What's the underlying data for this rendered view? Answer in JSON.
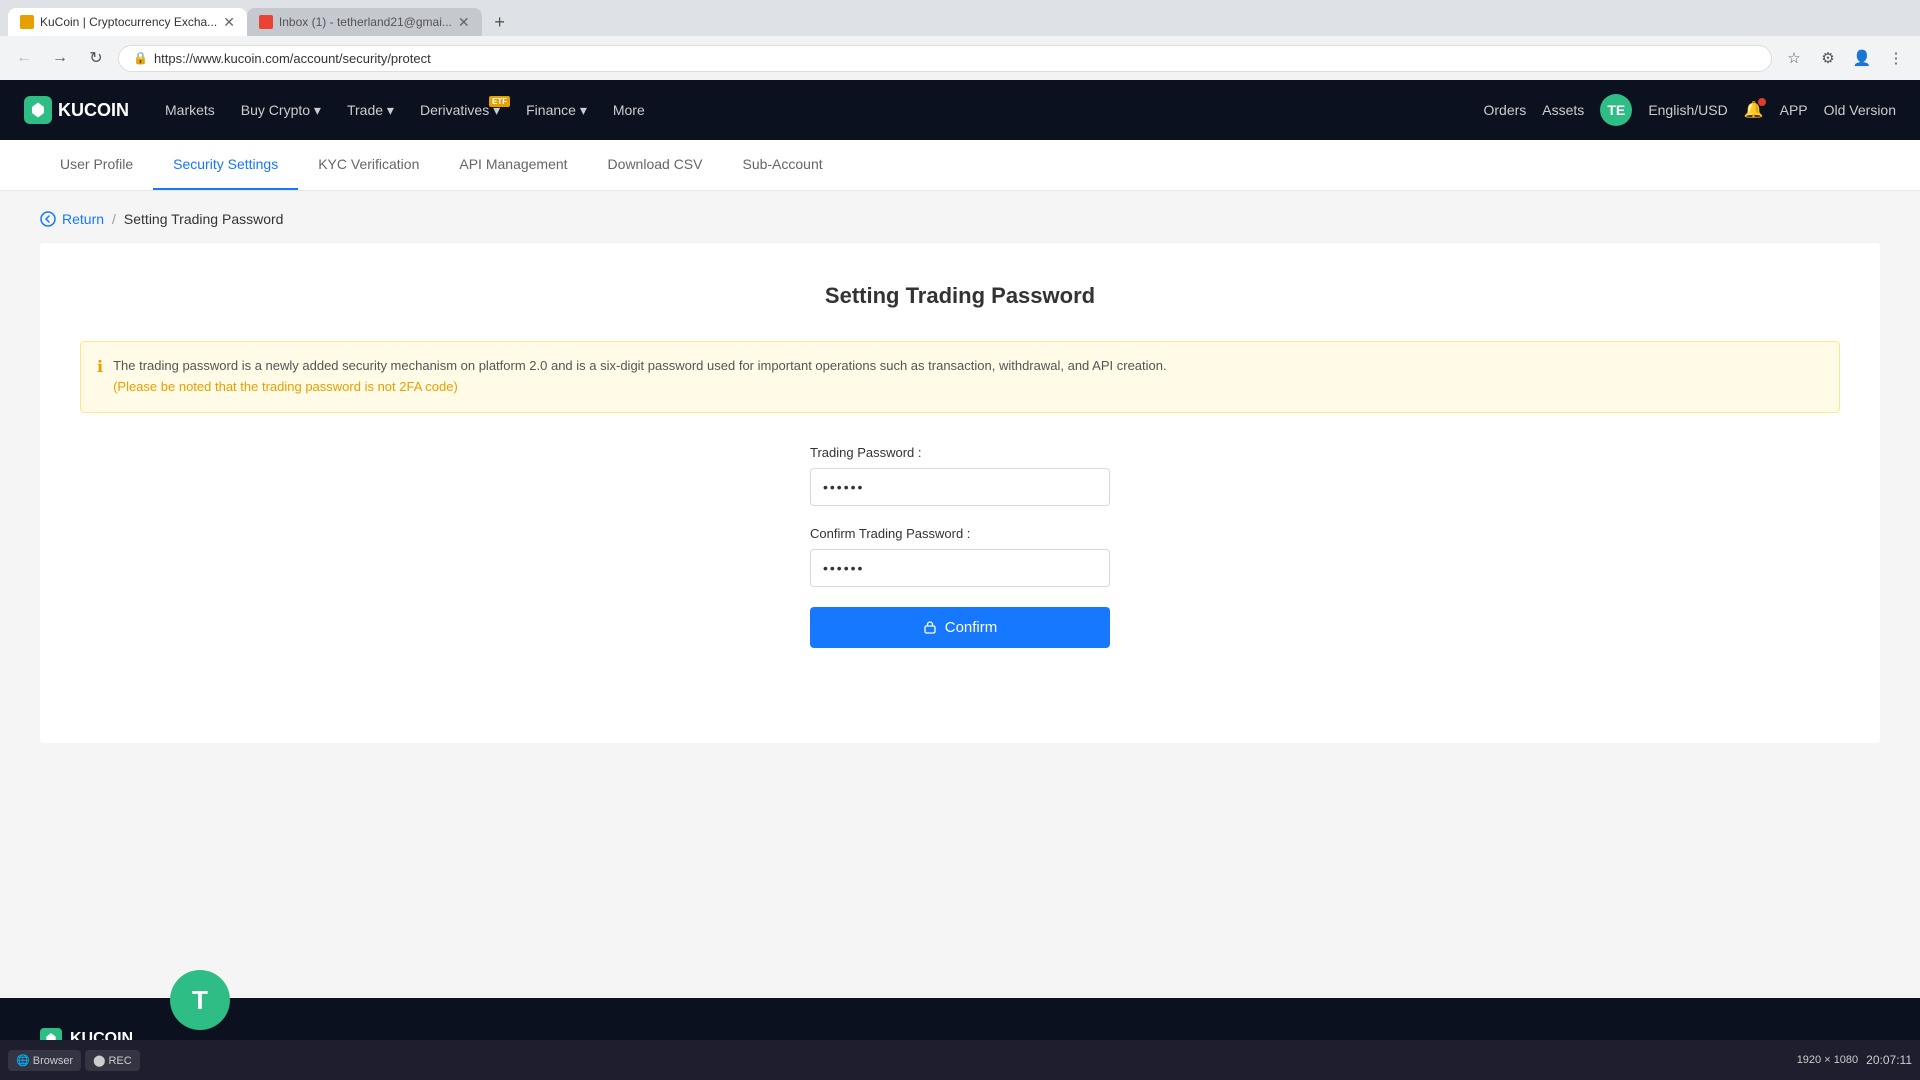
{
  "browser": {
    "tabs": [
      {
        "title": "KuCoin | Cryptocurrency Excha...",
        "favicon": "kucoin",
        "active": true
      },
      {
        "title": "Inbox (1) - tetherland21@gmai...",
        "favicon": "gmail",
        "active": false
      }
    ],
    "url": "https://www.kucoin.com/account/security/protect",
    "new_tab_label": "+"
  },
  "navbar": {
    "logo_letter": "K",
    "logo_text": "KUCOIN",
    "links": [
      {
        "label": "Markets",
        "has_etf": false
      },
      {
        "label": "Buy Crypto",
        "has_arrow": true,
        "has_etf": false
      },
      {
        "label": "Trade",
        "has_arrow": true,
        "has_etf": false
      },
      {
        "label": "Derivatives",
        "has_arrow": true,
        "has_etf": true
      },
      {
        "label": "Finance",
        "has_arrow": true,
        "has_etf": false
      },
      {
        "label": "More",
        "has_arrow": true,
        "has_etf": false
      }
    ],
    "right": {
      "orders": "Orders",
      "assets": "Assets",
      "avatar": "TE",
      "language": "English/USD",
      "app": "APP",
      "old_version": "Old Version"
    }
  },
  "account_tabs": [
    {
      "label": "User Profile",
      "active": false
    },
    {
      "label": "Security Settings",
      "active": true
    },
    {
      "label": "KYC Verification",
      "active": false
    },
    {
      "label": "API Management",
      "active": false
    },
    {
      "label": "Download CSV",
      "active": false
    },
    {
      "label": "Sub-Account",
      "active": false
    }
  ],
  "breadcrumb": {
    "return_label": "Return",
    "separator": "/",
    "current": "Setting Trading Password"
  },
  "main": {
    "page_title": "Setting Trading Password",
    "info_text": "The trading password is a newly added security mechanism on platform 2.0 and is a six-digit password used for important operations such as transaction, withdrawal, and API creation.",
    "info_warning": "(Please be noted that the trading password is not 2FA code)",
    "trading_password_label": "Trading Password :",
    "trading_password_value": "••••••",
    "confirm_password_label": "Confirm Trading Password :",
    "confirm_password_value": "••••••",
    "confirm_button": "Confirm"
  },
  "footer": {
    "logo_letter": "K",
    "logo_text": "KUCOIN"
  },
  "taskbar": {
    "time": "20:07:11",
    "resolution": "1920 × 1080"
  },
  "user_avatar": "T"
}
